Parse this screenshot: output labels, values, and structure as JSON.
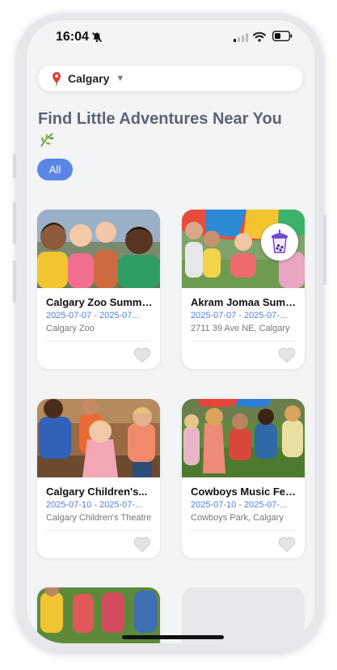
{
  "status": {
    "time": "16:04"
  },
  "location": {
    "city": "Calgary"
  },
  "heading": {
    "title": "Find Little Adventures Near You"
  },
  "filters": {
    "all": "All"
  },
  "events": [
    {
      "title": "Calgary Zoo Summer...",
      "dates": "2025-07-07 - 2025-07...",
      "place": "Calgary Zoo"
    },
    {
      "title": "Akram Jomaa Summer...",
      "dates": "2025-07-07 - 2025-07-...",
      "place": "2711 39 Ave NE, Calgary"
    },
    {
      "title": "Calgary Children's...",
      "dates": "2025-07-10 - 2025-07-...",
      "place": "Calgary Children's Theatre"
    },
    {
      "title": "Cowboys Music Fest...",
      "dates": "2025-07-10 - 2025-07-...",
      "place": "Cowboys Park, Calgary"
    }
  ],
  "colors": {
    "accent": "#5b86e5",
    "dates": "#4f7fd9",
    "title": "#5e6374"
  }
}
